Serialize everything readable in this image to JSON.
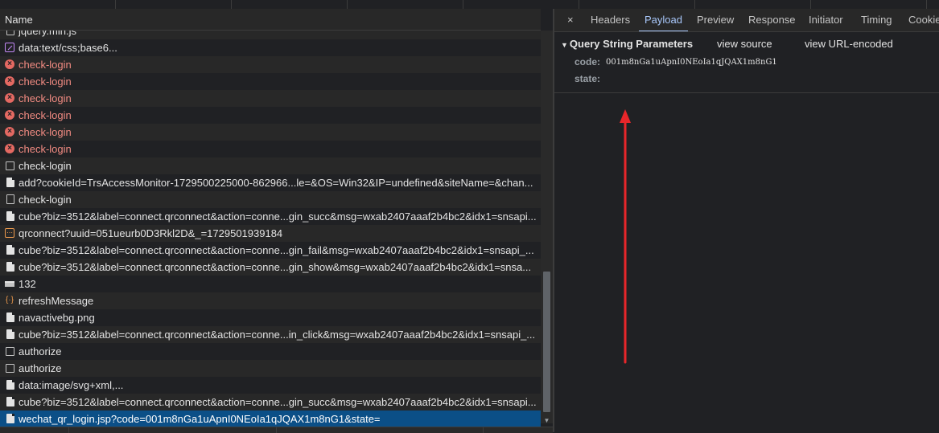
{
  "request_list": {
    "column_header": "Name",
    "rows": [
      {
        "name": "jquery.min.js",
        "icon": "script-icon",
        "status": "normal"
      },
      {
        "name": "data:text/css;base6...",
        "icon": "stylesheet-icon",
        "status": "normal"
      },
      {
        "name": "check-login",
        "icon": "error-icon",
        "status": "error"
      },
      {
        "name": "check-login",
        "icon": "error-icon",
        "status": "error"
      },
      {
        "name": "check-login",
        "icon": "error-icon",
        "status": "error"
      },
      {
        "name": "check-login",
        "icon": "error-icon",
        "status": "error"
      },
      {
        "name": "check-login",
        "icon": "error-icon",
        "status": "error"
      },
      {
        "name": "check-login",
        "icon": "error-icon",
        "status": "error"
      },
      {
        "name": "check-login",
        "icon": "box-icon",
        "status": "normal"
      },
      {
        "name": "add?cookieId=TrsAccessMonitor-1729500225000-862966...le=&OS=Win32&IP=undefined&siteName=&chan...",
        "icon": "document-icon",
        "status": "normal"
      },
      {
        "name": "check-login",
        "icon": "document-outline-icon",
        "status": "normal"
      },
      {
        "name": "cube?biz=3512&label=connect.qrconnect&action=conne...gin_succ&msg=wxab2407aaaf2b4bc2&idx1=snsapi...",
        "icon": "document-icon",
        "status": "normal"
      },
      {
        "name": "qrconnect?uuid=051ueurb0D3Rkl2D&_=1729501939184",
        "icon": "xhr-icon",
        "status": "normal"
      },
      {
        "name": "cube?biz=3512&label=connect.qrconnect&action=conne...gin_fail&msg=wxab2407aaaf2b4bc2&idx1=snsapi_...",
        "icon": "document-icon",
        "status": "normal"
      },
      {
        "name": "cube?biz=3512&label=connect.qrconnect&action=conne...gin_show&msg=wxab2407aaaf2b4bc2&idx1=snsa...",
        "icon": "document-icon",
        "status": "normal"
      },
      {
        "name": "132",
        "icon": "image-icon",
        "status": "normal"
      },
      {
        "name": "refreshMessage",
        "icon": "fetch-icon",
        "status": "normal"
      },
      {
        "name": "navactivebg.png",
        "icon": "document-icon",
        "status": "normal"
      },
      {
        "name": "cube?biz=3512&label=connect.qrconnect&action=conne...in_click&msg=wxab2407aaaf2b4bc2&idx1=snsapi_...",
        "icon": "document-icon",
        "status": "normal"
      },
      {
        "name": "authorize",
        "icon": "box-icon",
        "status": "normal"
      },
      {
        "name": "authorize",
        "icon": "box-icon",
        "status": "normal"
      },
      {
        "name": "data:image/svg+xml,...",
        "icon": "document-icon",
        "status": "normal"
      },
      {
        "name": "cube?biz=3512&label=connect.qrconnect&action=conne...gin_succ&msg=wxab2407aaaf2b4bc2&idx1=snsapi...",
        "icon": "document-icon",
        "status": "normal"
      },
      {
        "name": "wechat_qr_login.jsp?code=001m8nGa1uApnI0NEoIa1qJQAX1m8nG1&state=",
        "icon": "document-icon",
        "status": "selected"
      }
    ]
  },
  "details": {
    "close_label": "×",
    "tabs": [
      "Headers",
      "Payload",
      "Preview",
      "Response",
      "Initiator",
      "Timing",
      "Cookies"
    ],
    "active_tab": "Payload",
    "query_section": {
      "title": "Query String Parameters",
      "view_source": "view source",
      "view_url_encoded": "view URL-encoded",
      "params": [
        {
          "key": "code:",
          "value": "001m8nGa1uApnI0NEoIa1qJQAX1m8nG1"
        },
        {
          "key": "state:",
          "value": ""
        }
      ]
    }
  },
  "colors": {
    "background": "#202124",
    "error_text": "#f28b82",
    "selected_row": "#0b4f87",
    "active_tab": "#a8c7fa",
    "annotation_arrow": "#e8262a"
  }
}
